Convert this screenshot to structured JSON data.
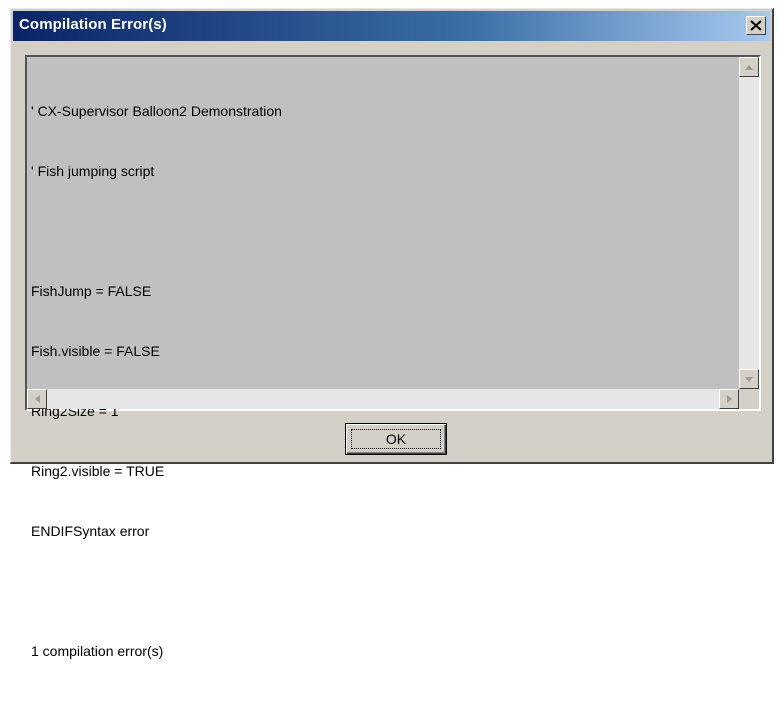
{
  "window": {
    "title": "Compilation Error(s)",
    "close_icon": "close-x-icon"
  },
  "output": {
    "lines": [
      "' CX-Supervisor Balloon2 Demonstration",
      "' Fish jumping script",
      "",
      "FishJump = FALSE",
      "Fish.visible = FALSE",
      "Ring2Size = 1",
      "Ring2.visible = TRUE",
      "ENDIFSyntax error",
      "",
      "1 compilation error(s)"
    ]
  },
  "buttons": {
    "ok_label": "OK"
  },
  "colors": {
    "title_gradient_start": "#0a246a",
    "title_gradient_end": "#a6caf0",
    "dialog_face": "#d4d0c8",
    "text_area": "#c0c0c0"
  }
}
